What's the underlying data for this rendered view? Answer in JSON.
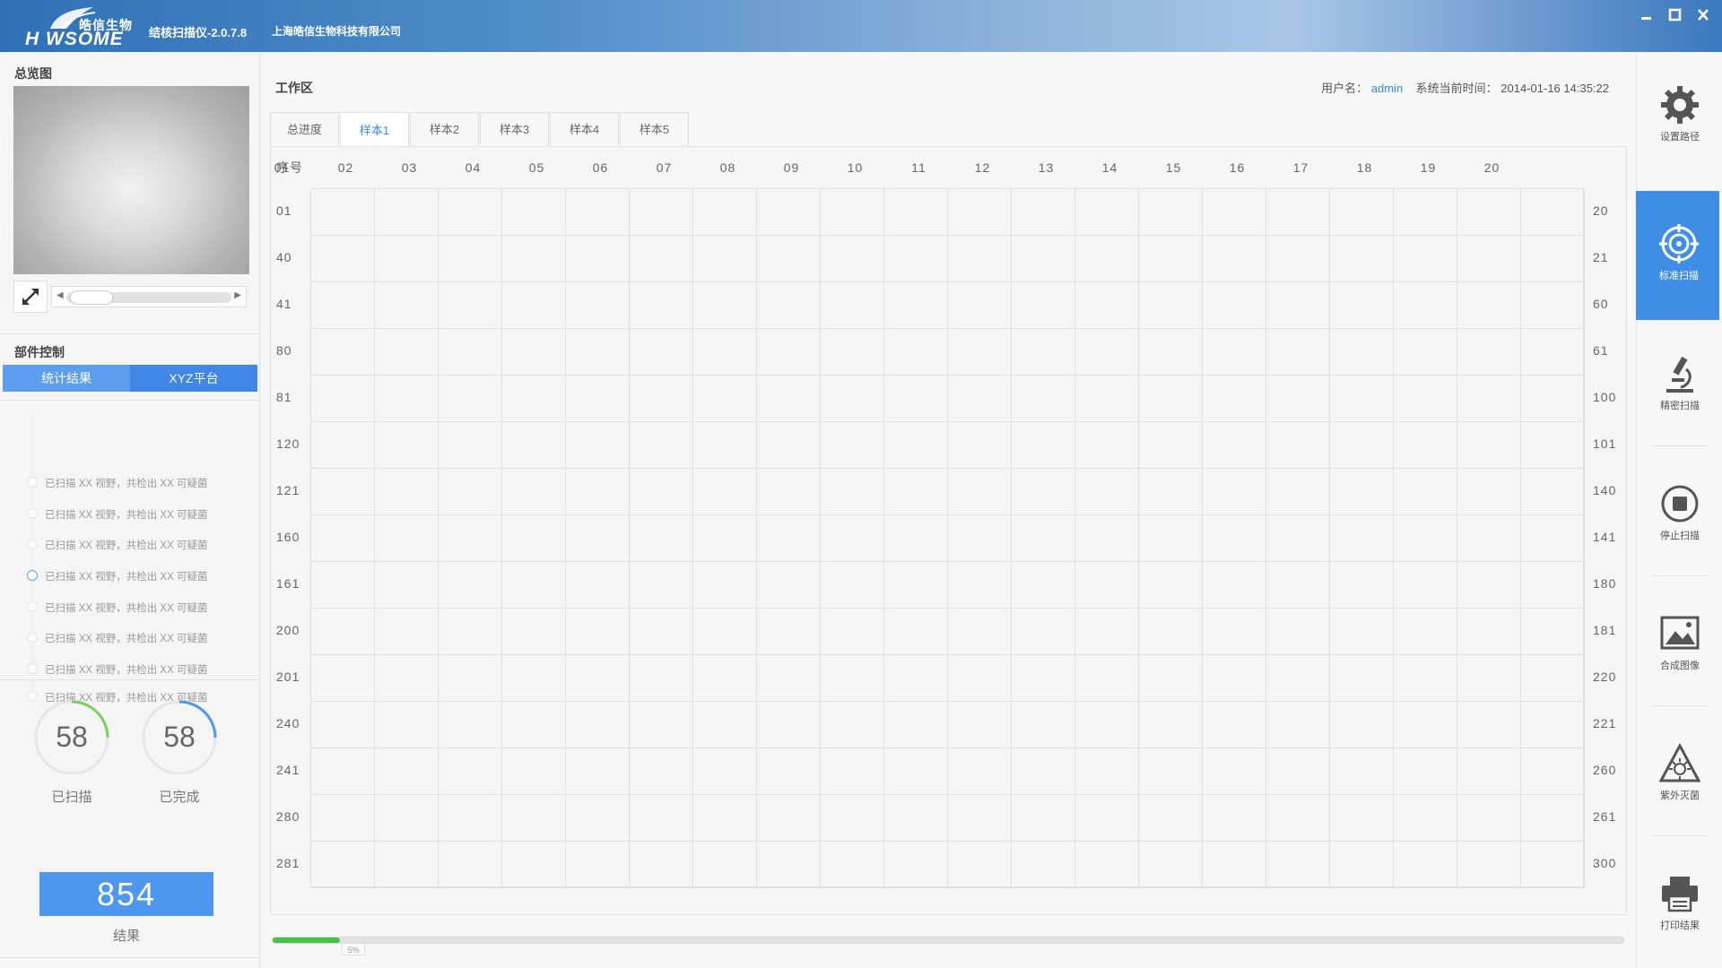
{
  "titlebar": {
    "logo_cn": "皓信生物",
    "logo_en": "H WSOME",
    "app_title": "结核扫描仪-2.0.7.8",
    "company": "上海皓信生物科技有限公司",
    "buttons": [
      "minimize-icon",
      "maximize-icon",
      "close-icon"
    ]
  },
  "overview": {
    "title": "总览图"
  },
  "component_control": {
    "title": "部件控制",
    "tabs": [
      "统计结果",
      "XYZ平台"
    ]
  },
  "timeline": [
    {
      "text": "已扫描 XX 视野，共检出 XX 可疑菌",
      "active": false
    },
    {
      "text": "已扫描 XX 视野，共检出 XX 可疑菌",
      "active": false
    },
    {
      "text": "已扫描 XX 视野，共检出 XX 可疑菌",
      "active": false
    },
    {
      "text": "已扫描 XX 视野，共检出 XX 可疑菌",
      "active": true
    },
    {
      "text": "已扫描 XX 视野，共检出 XX 可疑菌",
      "active": false
    },
    {
      "text": "已扫描 XX 视野，共检出 XX 可疑菌",
      "active": false
    },
    {
      "text": "已扫描 XX 视野，共检出 XX 可疑菌",
      "active": false
    },
    {
      "text": "已扫描 XX 视野，共检出 XX 可疑菌",
      "active": false
    }
  ],
  "stats": {
    "scanned": {
      "value": "58",
      "label": "已扫描",
      "color": "#7cd05c"
    },
    "completed": {
      "value": "58",
      "label": "已完成",
      "color": "#4e97ee"
    },
    "result": {
      "value": "854",
      "label": "结果"
    }
  },
  "status_dots": [
    "#74aaf0",
    "#74aaf0",
    "#74aaf0",
    "#74aaf0",
    "#d7d7d7"
  ],
  "workspace": {
    "title": "工作区",
    "user_label": "用户名：",
    "user": "admin",
    "time_label": "系统当前时间：",
    "time": "2014-01-16 14:35:22",
    "tabs": [
      "总进度",
      "样本1",
      "样本2",
      "样本3",
      "样本4",
      "样本5"
    ],
    "active_tab": 1,
    "seq_label": "序号",
    "columns": [
      "01",
      "02",
      "03",
      "04",
      "05",
      "06",
      "07",
      "08",
      "09",
      "10",
      "11",
      "12",
      "13",
      "14",
      "15",
      "16",
      "17",
      "18",
      "19",
      "20"
    ],
    "left_rows": [
      "01",
      "40",
      "41",
      "80",
      "81",
      "120",
      "121",
      "160",
      "161",
      "200",
      "201",
      "240",
      "241",
      "280",
      "281"
    ],
    "right_rows": [
      "20",
      "21",
      "60",
      "61",
      "100",
      "101",
      "140",
      "141",
      "180",
      "181",
      "220",
      "221",
      "260",
      "261",
      "300"
    ],
    "progress": {
      "percent": 5,
      "label": "5%"
    }
  },
  "toolbar": [
    {
      "label": "设置路径",
      "icon": "gear-icon",
      "active": false
    },
    {
      "label": "标准扫描",
      "icon": "target-icon",
      "active": true
    },
    {
      "label": "精密扫描",
      "icon": "microscope-icon",
      "active": false
    },
    {
      "label": "停止扫描",
      "icon": "stop-icon",
      "active": false
    },
    {
      "label": "合成图像",
      "icon": "image-icon",
      "active": false
    },
    {
      "label": "紫外灭菌",
      "icon": "uv-icon",
      "active": false
    },
    {
      "label": "打印结果",
      "icon": "printer-icon",
      "active": false
    }
  ],
  "colors": {
    "accent": "#3f8ee6",
    "progress": "#46c146"
  }
}
